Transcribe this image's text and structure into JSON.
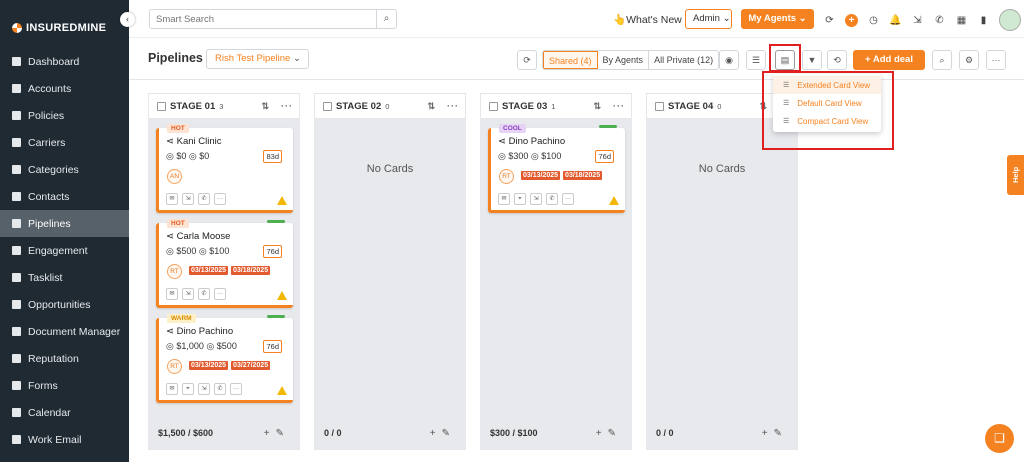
{
  "brand": {
    "name": "INSUREDMINE",
    "accent": "#f58220"
  },
  "sidebar": {
    "collapse_icon": "‹",
    "items": [
      {
        "label": "Dashboard",
        "icon": "dashboard-icon"
      },
      {
        "label": "Accounts",
        "icon": "accounts-icon"
      },
      {
        "label": "Policies",
        "icon": "policies-icon"
      },
      {
        "label": "Carriers",
        "icon": "carriers-icon"
      },
      {
        "label": "Categories",
        "icon": "categories-icon"
      },
      {
        "label": "Contacts",
        "icon": "contacts-icon"
      },
      {
        "label": "Pipelines",
        "icon": "pipelines-icon",
        "active": true
      },
      {
        "label": "Engagement",
        "icon": "engagement-icon"
      },
      {
        "label": "Tasklist",
        "icon": "tasklist-icon"
      },
      {
        "label": "Opportunities",
        "icon": "opportunities-icon"
      },
      {
        "label": "Document Manager",
        "icon": "document-icon"
      },
      {
        "label": "Reputation",
        "icon": "reputation-icon"
      },
      {
        "label": "Forms",
        "icon": "forms-icon"
      },
      {
        "label": "Calendar",
        "icon": "calendar-icon"
      },
      {
        "label": "Work Email",
        "icon": "email-icon"
      }
    ]
  },
  "topbar": {
    "search_placeholder": "Smart Search",
    "whats_new": "What's New",
    "admin_label": "Admin",
    "my_agents_label": "My Agents"
  },
  "subheader": {
    "title": "Pipelines",
    "pipeline_selected": "Rish Test Pipeline",
    "filters": {
      "shared": "Shared (4)",
      "by_agents": "By Agents",
      "all_private": "All Private (12)"
    },
    "add_deal_label": "+ Add deal"
  },
  "view_menu": {
    "items": [
      {
        "label": "Extended Card View",
        "selected": true
      },
      {
        "label": "Default Card View",
        "selected": false
      },
      {
        "label": "Compact Card View",
        "selected": false
      }
    ]
  },
  "stages": [
    {
      "name": "STAGE 01",
      "count": "3",
      "total": "$1,500 / $600",
      "cards": [
        {
          "tag": "HOT",
          "name": "Kani Clinic",
          "v1": "$0",
          "v2": "$0",
          "days": "83d",
          "initials": "AN",
          "dates": []
        },
        {
          "tag": "HOT",
          "name": "Carla Moose",
          "v1": "$500",
          "v2": "$100",
          "days": "76d",
          "initials": "RT",
          "dates": [
            "03/13/2025",
            "03/18/2025"
          ]
        },
        {
          "tag": "WARM",
          "name": "Dino Pachino",
          "v1": "$1,000",
          "v2": "$500",
          "days": "76d",
          "initials": "RT",
          "dates": [
            "03/13/2025",
            "03/27/2025"
          ]
        }
      ]
    },
    {
      "name": "STAGE 02",
      "count": "0",
      "total": "0 / 0",
      "empty_label": "No Cards",
      "cards": []
    },
    {
      "name": "STAGE 03",
      "count": "1",
      "total": "$300 / $100",
      "cards": [
        {
          "tag": "COOL",
          "name": "Dino Pachino",
          "v1": "$300",
          "v2": "$100",
          "days": "76d",
          "initials": "RT",
          "dates": [
            "03/13/2025",
            "03/18/2025"
          ]
        }
      ]
    },
    {
      "name": "STAGE 04",
      "count": "0",
      "total": "0 / 0",
      "empty_label": "No Cards",
      "cards": []
    }
  ],
  "help_label": "Help"
}
